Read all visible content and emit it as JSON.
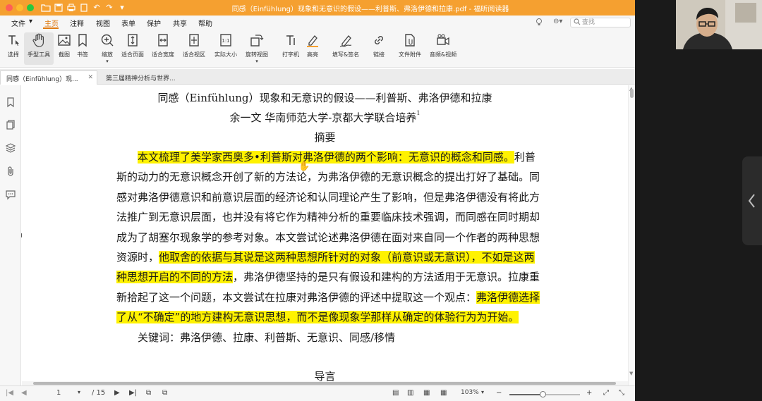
{
  "window": {
    "title": "同感（Einfühlung）现象和无意识的假设——利普斯、弗洛伊德和拉康.pdf - 福昕阅读器"
  },
  "menu": {
    "items": [
      "文件",
      "主页",
      "注释",
      "视图",
      "表单",
      "保护",
      "共享",
      "帮助"
    ],
    "active": "主页",
    "search_placeholder": "查找"
  },
  "toolbar": {
    "tools": [
      {
        "label": "选择",
        "icon": "select-text-icon"
      },
      {
        "label": "手型工具",
        "icon": "hand-icon"
      },
      {
        "label": "截图",
        "icon": "snapshot-icon"
      },
      {
        "label": "书签",
        "icon": "bookmark-icon"
      },
      {
        "label": "缩放",
        "icon": "zoom-icon"
      },
      {
        "label": "适合页面",
        "icon": "fit-page-icon"
      },
      {
        "label": "适合宽度",
        "icon": "fit-width-icon"
      },
      {
        "label": "适合视区",
        "icon": "fit-visible-icon"
      },
      {
        "label": "实际大小",
        "icon": "actual-size-icon"
      },
      {
        "label": "旋转视图",
        "icon": "rotate-icon"
      },
      {
        "label": "打字机",
        "icon": "typewriter-icon"
      },
      {
        "label": "高亮",
        "icon": "highlight-icon"
      },
      {
        "label": "填写&签名",
        "icon": "fill-sign-icon"
      },
      {
        "label": "链接",
        "icon": "link-icon"
      },
      {
        "label": "文件附件",
        "icon": "attachment-icon"
      },
      {
        "label": "音频&视频",
        "icon": "audio-video-icon"
      }
    ]
  },
  "tabs": [
    {
      "label": "同感（Einfühlung）现...",
      "active": true
    },
    {
      "label": "第三届精神分析与世界...",
      "active": false
    }
  ],
  "document": {
    "title": "同感（Einfühlung）现象和无意识的假设——利普斯、弗洛伊德和拉康",
    "author": "余一文 华南师范大学-京都大学联合培养",
    "author_footnote": "1",
    "abstract_heading": "摘要",
    "paragraph_lines": [
      [
        {
          "t": "本文梳理了美学家西奥多•利普斯对弗洛伊德的两个影响：无意识的概念和同感。",
          "h": true
        },
        {
          "t": "利普",
          "h": false
        }
      ],
      [
        {
          "t": "斯的动力的无意识概念开创了新的方法论，为弗洛伊德的无意识概念的提出打好了基础。同",
          "h": false
        }
      ],
      [
        {
          "t": "感对弗洛伊德意识和前意识层面的经济论和认同理论产生了影响，但是弗洛伊德没有将此方",
          "h": false
        }
      ],
      [
        {
          "t": "法推广到无意识层面，也并没有将它作为精神分析的重要临床技术强调，而同感在同时期却",
          "h": false
        }
      ],
      [
        {
          "t": "成为了胡塞尔现象学的参考对象。本文尝试论述弗洛伊德在面对来自同一个作者的两种思想",
          "h": false
        }
      ],
      [
        {
          "t": "资源时，",
          "h": false
        },
        {
          "t": "他取舍的依据与其说是这两种思想所针对的对象（前意识或无意识），不如是这两",
          "h": true
        }
      ],
      [
        {
          "t": "种思想开启的不同的方法",
          "h": true
        },
        {
          "t": "，弗洛伊德坚持的是只有假设和建构的方法适用于无意识。拉康重",
          "h": false
        }
      ],
      [
        {
          "t": "新拾起了这一个问题，本文尝试在拉康对弗洛伊德的评述中提取这一个观点：",
          "h": false
        },
        {
          "t": "弗洛伊德选择",
          "h": true
        }
      ],
      [
        {
          "t": "了从“不确定”的地方建构无意识思想，而不是像现象学那样从确定的体验行为为开始。",
          "h": true
        }
      ]
    ],
    "keywords": "关键词：弗洛伊德、拉康、利普斯、无意识、同感/移情",
    "next_heading": "导言"
  },
  "status": {
    "current_page": "1",
    "total_pages": "/ 15",
    "zoom": "103%",
    "zoom_fraction": 0.47
  },
  "colors": {
    "titlebar": "#f5a030",
    "accent": "#e07a10",
    "highlight": "#fff200"
  }
}
